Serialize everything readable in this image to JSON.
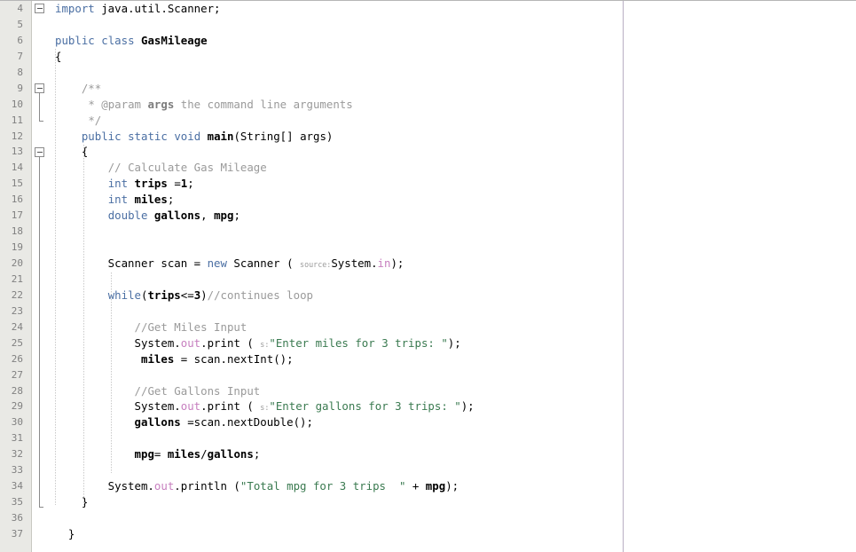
{
  "editor": {
    "language": "Java",
    "file_type": "java-source",
    "first_visible_line": 4,
    "last_visible_line": 37,
    "margin_column_guide": true,
    "colors": {
      "background": "#ffffff",
      "gutter_background": "#e9e9e5",
      "line_number": "#808080",
      "keyword": "#4b6fa3",
      "string": "#3a7a50",
      "comment": "#9a9a9a",
      "field": "#c77fbf",
      "parameter_hint": "#9b9b9b",
      "margin_line": "#b9aec4",
      "indent_guide": "#c9c9c9"
    },
    "line_numbers": [
      "4",
      "5",
      "6",
      "7",
      "8",
      "9",
      "10",
      "11",
      "12",
      "13",
      "14",
      "15",
      "16",
      "17",
      "18",
      "19",
      "20",
      "21",
      "22",
      "23",
      "24",
      "25",
      "26",
      "27",
      "28",
      "29",
      "30",
      "31",
      "32",
      "33",
      "34",
      "35",
      "36",
      "37"
    ],
    "code_text": [
      "import java.util.Scanner;",
      "",
      "public class GasMileage",
      "{",
      "",
      "    /**",
      "     * @param args the command line arguments",
      "     */",
      "    public static void main(String[] args)",
      "    {",
      "        // Calculate Gas Mileage",
      "        int trips =1;",
      "        int miles;",
      "        double gallons, mpg;",
      "",
      "",
      "        Scanner scan = new Scanner ( source:System.in);",
      "",
      "        while(trips<=3)//continues loop",
      "",
      "            //Get Miles Input",
      "            System.out.print ( s:\"Enter miles for 3 trips: \");",
      "             miles = scan.nextInt();",
      "",
      "            //Get Gallons Input",
      "            System.out.print ( s:\"Enter gallons for 3 trips: \");",
      "            gallons =scan.nextDouble();",
      "",
      "            mpg= miles/gallons;",
      "",
      "        System.out.println (\"Total mpg for 3 trips  \" + mpg);",
      "    }",
      "",
      "  }"
    ],
    "parameter_hints": [
      {
        "line": 20,
        "label": "source:"
      },
      {
        "line": 25,
        "label": "s:"
      },
      {
        "line": 29,
        "label": "s:"
      }
    ],
    "fold_markers": [
      {
        "line": 4,
        "state": "expanded"
      },
      {
        "line": 9,
        "state": "expanded",
        "ends_at_line": 11
      },
      {
        "line": 13,
        "state": "expanded",
        "ends_at_line": 35
      }
    ],
    "class_name": "GasMileage",
    "method_name": "main",
    "strings": [
      "\"Enter miles for 3 trips: \"",
      "\"Enter gallons for 3 trips: \"",
      "\"Total mpg for 3 trips  \""
    ],
    "comments": [
      "// Calculate Gas Mileage",
      "//continues loop",
      "//Get Miles Input",
      "//Get Gallons Input"
    ],
    "javadoc": "* @param args the command line arguments"
  }
}
